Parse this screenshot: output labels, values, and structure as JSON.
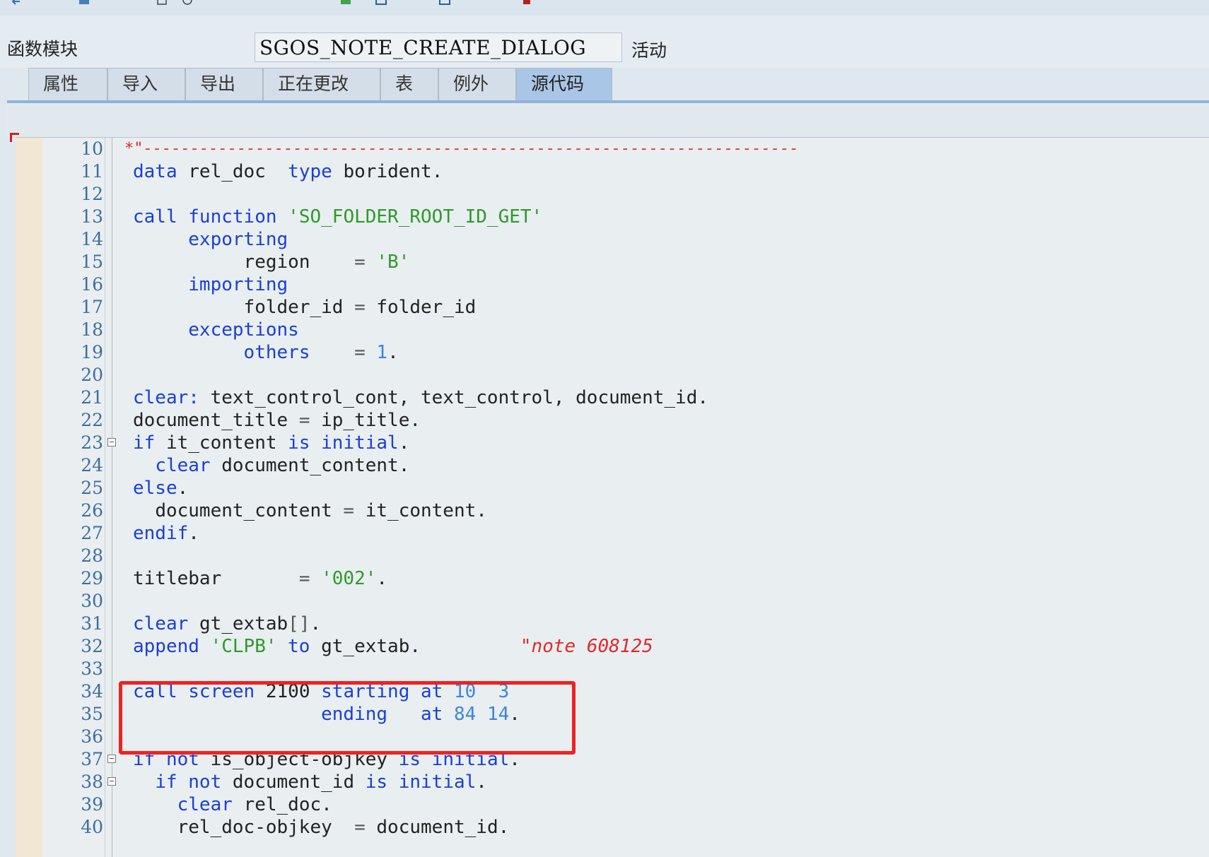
{
  "toolbar": {
    "icons": [
      "back-icon",
      "save-icon",
      "check-icon",
      "activate-icon",
      "test-icon",
      "where-used-icon",
      "display-object-list-icon",
      "help-icon"
    ]
  },
  "header": {
    "function_module_label": "函数模块",
    "function_module_name": "SGOS_NOTE_CREATE_DIALOG",
    "status": "活动"
  },
  "tabs": [
    {
      "label": "属性",
      "active": false
    },
    {
      "label": "导入",
      "active": false
    },
    {
      "label": "导出",
      "active": false
    },
    {
      "label": "正在更改",
      "active": false
    },
    {
      "label": "表",
      "active": false
    },
    {
      "label": "例外",
      "active": false
    },
    {
      "label": "源代码",
      "active": true
    }
  ],
  "code": {
    "comment_dashes": "*\"----------------------------------------------------------------------",
    "lines": [
      {
        "n": "10"
      },
      {
        "n": "11"
      },
      {
        "n": "12"
      },
      {
        "n": "13"
      },
      {
        "n": "14"
      },
      {
        "n": "15"
      },
      {
        "n": "16"
      },
      {
        "n": "17"
      },
      {
        "n": "18"
      },
      {
        "n": "19"
      },
      {
        "n": "20"
      },
      {
        "n": "21"
      },
      {
        "n": "22"
      },
      {
        "n": "23"
      },
      {
        "n": "24"
      },
      {
        "n": "25"
      },
      {
        "n": "26"
      },
      {
        "n": "27"
      },
      {
        "n": "28"
      },
      {
        "n": "29"
      },
      {
        "n": "30"
      },
      {
        "n": "31"
      },
      {
        "n": "32"
      },
      {
        "n": "33"
      },
      {
        "n": "34"
      },
      {
        "n": "35"
      },
      {
        "n": "36"
      },
      {
        "n": "37"
      },
      {
        "n": "38"
      },
      {
        "n": "39"
      },
      {
        "n": "40"
      }
    ],
    "text": {
      "data": "data",
      "rel_doc": "rel_doc",
      "type": "type",
      "borident": "borident",
      "call": "call",
      "function": "function",
      "fm_name": "'SO_FOLDER_ROOT_ID_GET'",
      "exporting": "exporting",
      "region": "region",
      "eq": "=",
      "b": "'B'",
      "importing": "importing",
      "folder_id": "folder_id",
      "exceptions": "exceptions",
      "others": "others",
      "one": "1",
      "clear": "clear",
      "clear_colon": "clear:",
      "text_control_cont": "text_control_cont,",
      "text_control": "text_control,",
      "document_id": "document_id",
      "document_title": "document_title",
      "ip_title": "ip_title",
      "if": "if",
      "it_content": "it_content",
      "is": "is",
      "initial": "initial",
      "document_content": "document_content",
      "else": "else",
      "endif": "endif",
      "titlebar": "titlebar",
      "v002": "'002'",
      "gt_extab": "gt_extab",
      "brackets": "[]",
      "append": "append",
      "clpb": "'CLPB'",
      "to": "to",
      "note_comment": "\"note 608125",
      "screen": "screen",
      "n2100": "2100",
      "starting": "starting",
      "at": "at",
      "n10": "10",
      "n3": "3",
      "ending": "ending",
      "n84": "84",
      "n14": "14",
      "not": "not",
      "is_object_objkey": "is_object-objkey",
      "rel_doc_objkey": "rel_doc-objkey",
      "dot": "."
    }
  }
}
